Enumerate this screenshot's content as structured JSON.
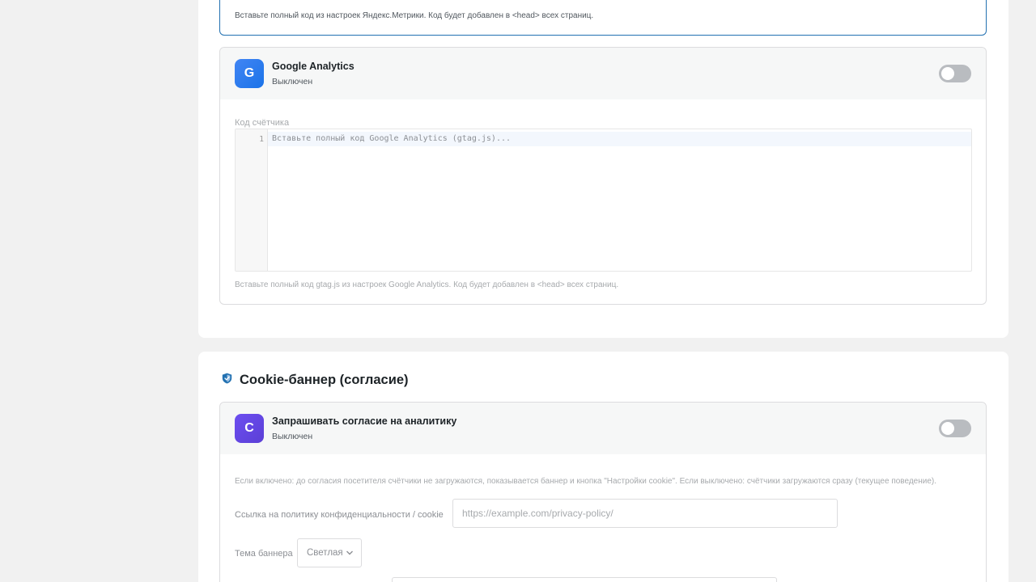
{
  "yandex": {
    "hint": "Вставьте полный код из настроек Яндекс.Метрики. Код будет добавлен в <head> всех страниц."
  },
  "google_analytics": {
    "logo_letter": "G",
    "title": "Google Analytics",
    "status": "Выключен",
    "enabled": false,
    "code_label": "Код счётчика",
    "line_number": "1",
    "code_placeholder": "Вставьте полный код Google Analytics (gtag.js)...",
    "hint": "Вставьте полный код gtag.js из настроек Google Analytics. Код будет добавлен в <head> всех страниц."
  },
  "cookie_section": {
    "title": "Cookie-баннер (согласие)",
    "icon": "shield-icon",
    "consent": {
      "logo_letter": "C",
      "title": "Запрашивать согласие на аналитику",
      "status": "Выключен",
      "enabled": false
    },
    "hint": "Если включено: до согласия посетителя счётчики не загружаются, показывается баннер и кнопка \"Настройки cookie\". Если выключено: счётчики загружаются сразу (текущее поведение).",
    "privacy_link_label": "Ссылка на политику конфиденциальности / cookie",
    "privacy_link_placeholder": "https://example.com/privacy-policy/",
    "privacy_link_value": "",
    "theme_label": "Тема баннера",
    "theme_value": "Светлая"
  },
  "colors": {
    "accent": "#2271b1",
    "ga_logo": "#1a73e8",
    "cookie_logo": "#5b3fd6",
    "toggle_off": "#b9bcc0",
    "page_background": "#f1f1f1"
  }
}
